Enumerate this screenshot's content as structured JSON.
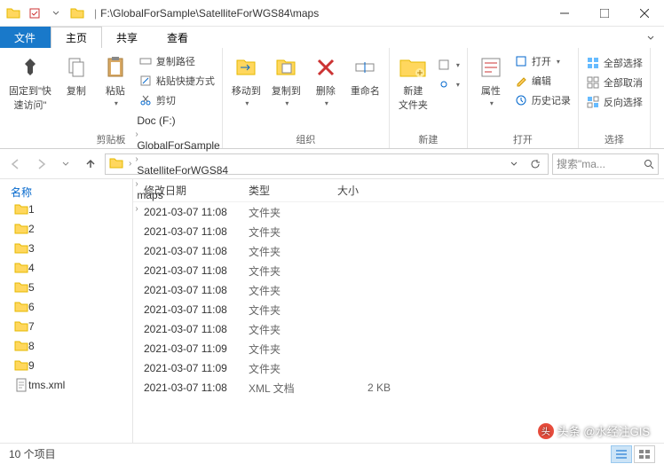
{
  "title_path": "F:\\GlobalForSample\\SatelliteForWGS84\\maps",
  "tabs": {
    "file": "文件",
    "home": "主页",
    "share": "共享",
    "view": "查看"
  },
  "ribbon": {
    "pin": "固定到\"快\n速访问\"",
    "copy": "复制",
    "paste": "粘贴",
    "copy_path": "复制路径",
    "paste_shortcut": "粘贴快捷方式",
    "cut": "剪切",
    "clipboard_group": "剪贴板",
    "move_to": "移动到",
    "copy_to": "复制到",
    "delete": "删除",
    "rename": "重命名",
    "organize_group": "组织",
    "new_folder": "新建\n文件夹",
    "new_group": "新建",
    "properties": "属性",
    "open": "打开",
    "edit": "编辑",
    "history": "历史记录",
    "open_group": "打开",
    "select_all": "全部选择",
    "select_none": "全部取消",
    "invert_selection": "反向选择",
    "select_group": "选择"
  },
  "breadcrumbs": [
    "Doc (F:)",
    "GlobalForSample",
    "SatelliteForWGS84",
    "maps"
  ],
  "search_placeholder": "搜索\"ma...",
  "columns": {
    "name": "名称",
    "date": "修改日期",
    "type": "类型",
    "size": "大小"
  },
  "files": [
    {
      "name": "1",
      "date": "2021-03-07 11:08",
      "type": "文件夹",
      "size": "",
      "icon": "folder"
    },
    {
      "name": "2",
      "date": "2021-03-07 11:08",
      "type": "文件夹",
      "size": "",
      "icon": "folder"
    },
    {
      "name": "3",
      "date": "2021-03-07 11:08",
      "type": "文件夹",
      "size": "",
      "icon": "folder"
    },
    {
      "name": "4",
      "date": "2021-03-07 11:08",
      "type": "文件夹",
      "size": "",
      "icon": "folder"
    },
    {
      "name": "5",
      "date": "2021-03-07 11:08",
      "type": "文件夹",
      "size": "",
      "icon": "folder"
    },
    {
      "name": "6",
      "date": "2021-03-07 11:08",
      "type": "文件夹",
      "size": "",
      "icon": "folder"
    },
    {
      "name": "7",
      "date": "2021-03-07 11:08",
      "type": "文件夹",
      "size": "",
      "icon": "folder"
    },
    {
      "name": "8",
      "date": "2021-03-07 11:09",
      "type": "文件夹",
      "size": "",
      "icon": "folder"
    },
    {
      "name": "9",
      "date": "2021-03-07 11:09",
      "type": "文件夹",
      "size": "",
      "icon": "folder"
    },
    {
      "name": "tms.xml",
      "date": "2021-03-07 11:08",
      "type": "XML 文档",
      "size": "2 KB",
      "icon": "file"
    }
  ],
  "status": "10 个项目",
  "watermark": "头条 @水经注GIS"
}
